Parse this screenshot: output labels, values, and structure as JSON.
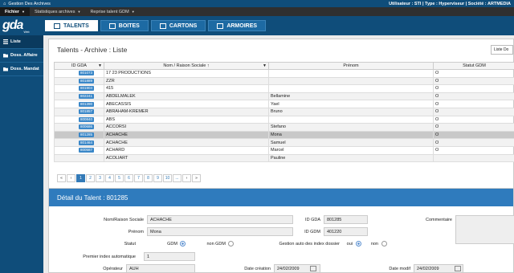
{
  "titlebar": {
    "app_title": "Gestion Des Archives",
    "user_info": "Utilisateur : STI  |  Type : Hyperviseur  |  Société : ARTMEDIA"
  },
  "menubar": {
    "items": [
      "Fichier",
      "Statistiques archives",
      "Reprise talent GDM"
    ]
  },
  "logo": {
    "main": "gda",
    "sub": "Web"
  },
  "sidebar": {
    "items": [
      {
        "label": "Liste",
        "icon": "list-icon"
      },
      {
        "label": "Doss. Affaire",
        "icon": "folder-icon"
      },
      {
        "label": "Doss. Mandat",
        "icon": "folder-icon"
      }
    ]
  },
  "tabs": [
    {
      "label": "TALENTS",
      "active": true
    },
    {
      "label": "BOITES",
      "active": false
    },
    {
      "label": "CARTONS",
      "active": false
    },
    {
      "label": "ARMOIRES",
      "active": false
    }
  ],
  "list": {
    "title": "Talents - Archive : Liste",
    "button": "Liste Do",
    "columns": [
      "ID GDA",
      "Nom / Raison Sociale ↑",
      "Prénom",
      "Statut GDM"
    ],
    "rows": [
      {
        "id": "801073",
        "name": "17 23 PRODUCTIONS",
        "prenom": "",
        "statut": "O"
      },
      {
        "id": "801889",
        "name": "ZZR",
        "prenom": "",
        "statut": "O"
      },
      {
        "id": "801904",
        "name": "415",
        "prenom": "",
        "statut": "O"
      },
      {
        "id": "802241",
        "name": "ABDELMALEK",
        "prenom": "Bellamine",
        "statut": "O"
      },
      {
        "id": "801390",
        "name": "ABECASSIS",
        "prenom": "Yael",
        "statut": "O"
      },
      {
        "id": "801857",
        "name": "ABRAHAM-KREMER",
        "prenom": "Bruno",
        "statut": "O"
      },
      {
        "id": "800840",
        "name": "ABS",
        "prenom": "",
        "statut": "O"
      },
      {
        "id": "800686",
        "name": "ACCORSI",
        "prenom": "Stefano",
        "statut": "O"
      },
      {
        "id": "801285",
        "name": "ACHACHE",
        "prenom": "Mona",
        "statut": "O"
      },
      {
        "id": "801464",
        "name": "ACHACHE",
        "prenom": "Samuel",
        "statut": "O"
      },
      {
        "id": "800587",
        "name": "ACHARD",
        "prenom": "Marcel",
        "statut": "O"
      },
      {
        "id": "",
        "name": "ACOLIART",
        "prenom": "Pauline",
        "statut": ""
      }
    ],
    "selected_row": 8,
    "pager": {
      "first": "«",
      "prev": "‹",
      "pages": [
        "1",
        "2",
        "3",
        "4",
        "5",
        "6",
        "7",
        "8",
        "9",
        "10",
        "..."
      ],
      "active_page": "1",
      "next": "›",
      "last": "»"
    }
  },
  "detail": {
    "header": "Détail du Talent : 801285",
    "fields": {
      "nom_label": "Nom/Raison Sociale",
      "nom_value": "ACHACHE",
      "prenom_label": "Prénom",
      "prenom_value": "Mona",
      "idgda_label": "ID GDA",
      "idgda_value": "801285",
      "idgdm_label": "ID GDM",
      "idgdm_value": "401220",
      "commentaire_label": "Commentaire",
      "statut_label": "Statut",
      "statut_gdm": "GDM",
      "statut_non_gdm": "non GDM",
      "gestion_label": "Gestion auto des index dossier",
      "gestion_oui": "oui",
      "gestion_non": "non",
      "premier_label": "Premier index automatique",
      "premier_value": "1",
      "operateur_label": "Opérateur",
      "operateur_value": "AUH",
      "date_creation_label": "Date création",
      "date_creation_value": "24/02/2009",
      "date_modif_label": "Date modif",
      "date_modif_value": "24/02/2009"
    }
  },
  "colors": {
    "brand_blue": "#0f4d7a",
    "header_blue": "#2f7bbd",
    "badge_blue": "#3a87c8"
  }
}
